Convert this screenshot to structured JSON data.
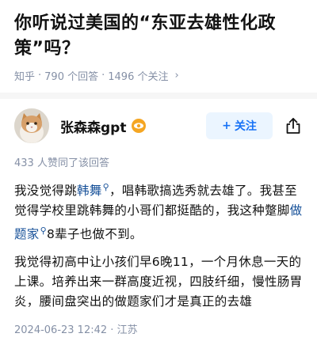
{
  "question": {
    "title": "你听说过美国的“东亚去雄性化政策”吗？",
    "source": "知乎",
    "answers": "790 个回答",
    "followers": "1496 个关注",
    "chevron": "›"
  },
  "answer": {
    "author": "张森森gpt",
    "badge_icon": "eye-badge-icon",
    "follow_label": "关注",
    "follow_plus": "+",
    "likes": "433 人赞同了该回答",
    "p1": {
      "t1": "我没觉得跳",
      "k1": "韩舞",
      "t2": "，唱韩歌搞选秀就去雄了。我甚至觉得学校里跳韩舞的小哥们都挺酷的，我这种蹩脚",
      "k2": "做题家",
      "t3": "8辈子也做不到。"
    },
    "p2": "我觉得初高中让小孩们早6晚11，一个月休息一天的上课。培养出来一群高度近视，四肢纤细，慢性肠胃炎，腰间盘突出的做题家们才是真正的去雄",
    "date": "2024-06-23 12:42",
    "location": "江苏",
    "dot": "·"
  },
  "colors": {
    "accent": "#1772f6",
    "keyword": "#175199",
    "meta": "#8590a6"
  }
}
